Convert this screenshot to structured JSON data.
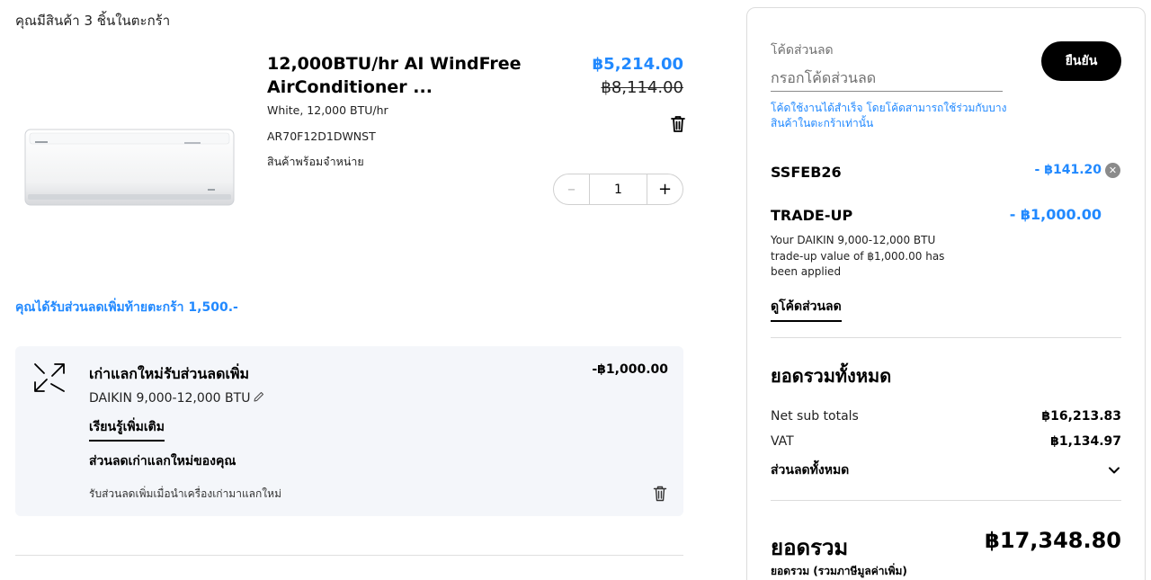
{
  "cart": {
    "count_text": "คุณมีสินค้า 3 ชิ้นในตะกร้า"
  },
  "product": {
    "title": "12,000BTU/hr AI WindFree AirConditioner ...",
    "variant": "White, 12,000 BTU/hr",
    "sku": "AR70F12D1DWNST",
    "stock": "สินค้าพร้อมจำหน่าย",
    "price_sale": "฿5,214.00",
    "price_original": "฿8,114.00",
    "quantity": "1",
    "image_icon": "air-conditioner-image"
  },
  "extra_discount": "คุณได้รับส่วนลดเพิ่มท้ายตะกร้า 1,500.-",
  "trade_in": {
    "title": "เก่าแลกใหม่รับส่วนลดเพิ่ม",
    "model": "DAIKIN 9,000-12,000 BTU",
    "learn_more": "เรียนรู้เพิ่มเติม",
    "subtitle": "ส่วนลดเก่าแลกใหม่ของคุณ",
    "description": "รับส่วนลดเพิ่มเมื่อนำเครื่องเก่ามาแลกใหม่",
    "amount": "-฿1,000.00"
  },
  "summary": {
    "promo_label": "โค้ดส่วนลด",
    "promo_placeholder": "กรอกโค้ดส่วนลด",
    "confirm_label": "ยืนยัน",
    "promo_hint": "โค้ดใช้งานได้สำเร็จ โดยโค้ดสามารถใช้ร่วมกับบางสินค้าในตะกร้าเท่านั้น",
    "code_name": "SSFEB26",
    "code_amount": "- ฿141.20",
    "tradeup_name": "TRADE-UP",
    "tradeup_amount": "- ฿1,000.00",
    "tradeup_desc": "Your DAIKIN 9,000-12,000 BTU trade-up value of ฿1,000.00 has been applied",
    "view_codes": "ดูโค้ดส่วนลด",
    "total_heading": "ยอดรวมทั้งหมด",
    "net_label": "Net sub totals",
    "net_value": "฿16,213.83",
    "vat_label": "VAT",
    "vat_value": "฿1,134.97",
    "discount_toggle": "ส่วนลดทั้งหมด",
    "grand_label": "ยอดรวม",
    "grand_value": "฿17,348.80",
    "grand_sub": "ยอดรวม (รวมภาษีมูลค่าเพิ่ม)"
  },
  "colors": {
    "accent": "#2189ff",
    "card_bg": "#f4f6fa",
    "button_bg": "#000000"
  }
}
